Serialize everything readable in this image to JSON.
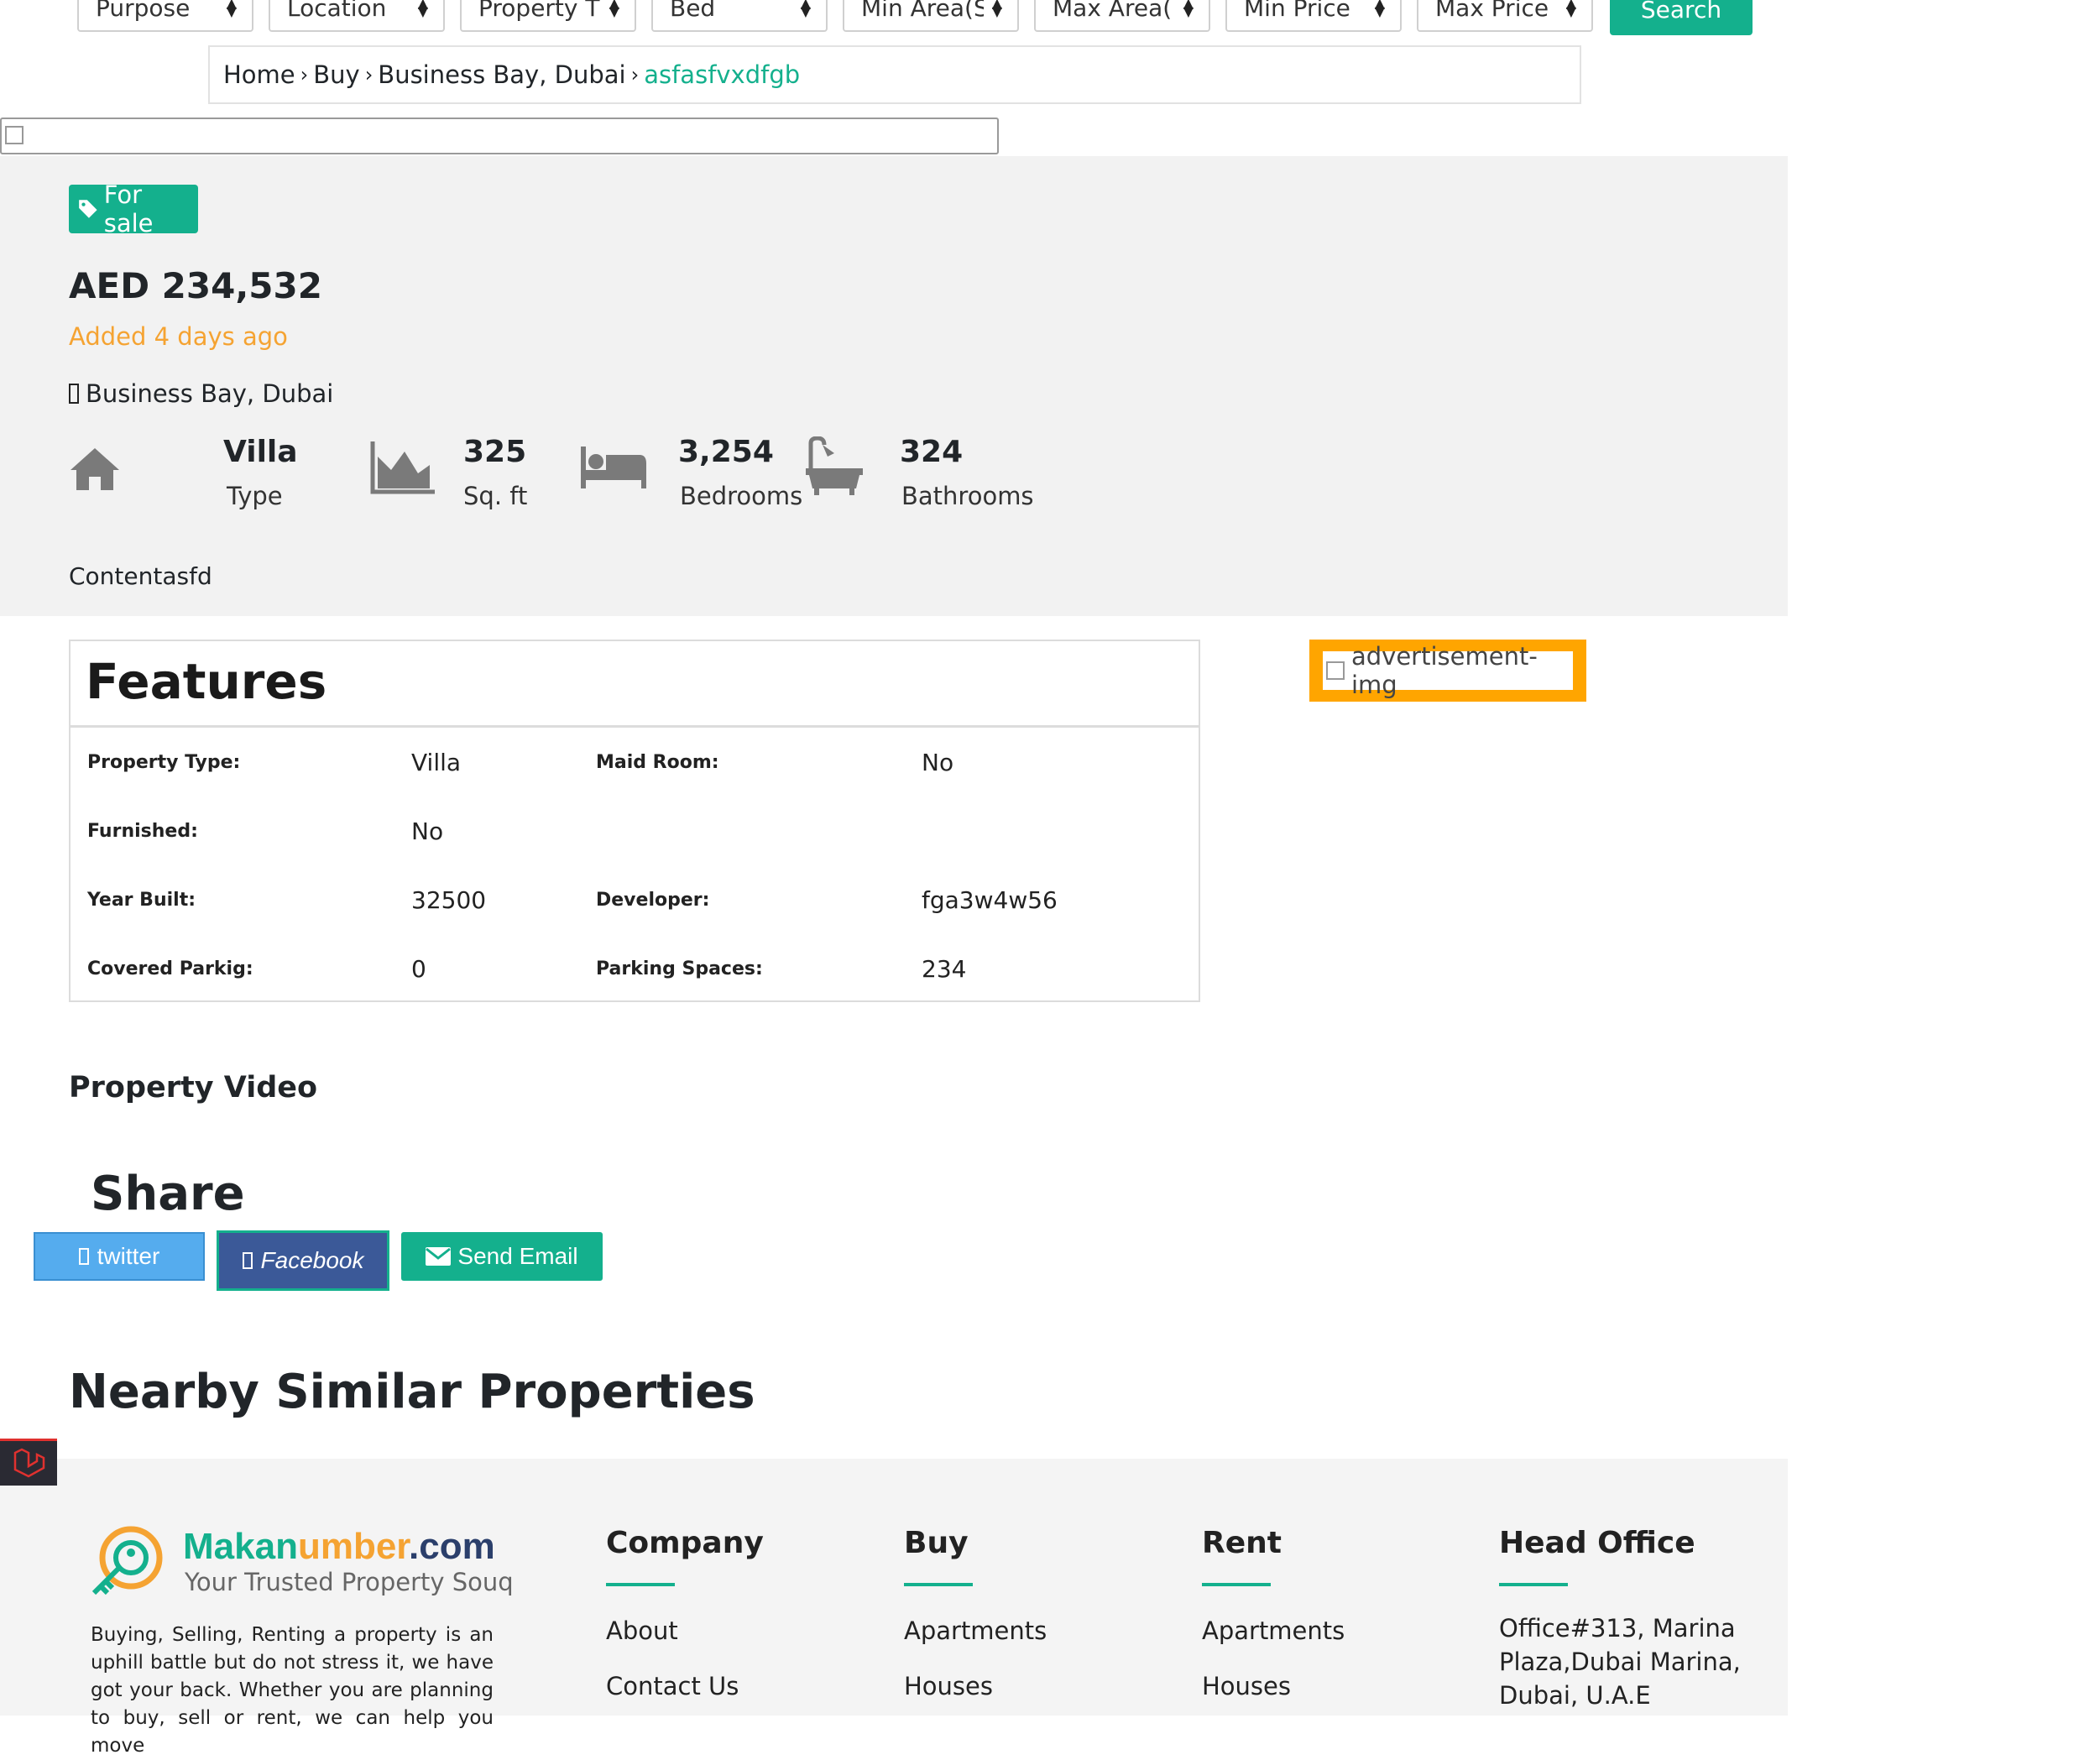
{
  "filters": [
    {
      "label": "Purpose"
    },
    {
      "label": "Location"
    },
    {
      "label": "Property T"
    },
    {
      "label": "Bed"
    },
    {
      "label": "Min Area(S"
    },
    {
      "label": "Max Area("
    },
    {
      "label": "Min Price"
    },
    {
      "label": "Max Price"
    }
  ],
  "search_label": "Search",
  "breadcrumb": {
    "home": "Home",
    "buy": "Buy",
    "location": "Business Bay, Dubai",
    "current": "asfasfvxdfgb"
  },
  "listing": {
    "badge": "For sale",
    "price": "AED 234,532",
    "added": "Added 4 days ago",
    "location": "Business Bay, Dubai",
    "content": "Contentasfd",
    "stats": {
      "type_value": "Villa",
      "type_label": "Type",
      "area_value": "325",
      "area_label": "Sq. ft",
      "bed_value": "3,254",
      "bed_label": "Bedrooms",
      "bath_value": "324",
      "bath_label": "Bathrooms"
    }
  },
  "features": {
    "title": "Features",
    "rows": [
      {
        "k1": "Property Type:",
        "v1": "Villa",
        "k2": "Maid Room:",
        "v2": "No"
      },
      {
        "k1": "Furnished:",
        "v1": "No",
        "k2": "",
        "v2": ""
      },
      {
        "k1": "Year Built:",
        "v1": "32500",
        "k2": "Developer:",
        "v2": "fga3w4w56"
      },
      {
        "k1": "Covered Parkig:",
        "v1": "0",
        "k2": "Parking Spaces:",
        "v2": "234"
      }
    ]
  },
  "advertisement_alt": "advertisement-img",
  "video_heading": "Property Video",
  "share": {
    "heading": "Share",
    "twitter": "twitter",
    "facebook": "Facebook",
    "email": "Send Email"
  },
  "nearby_heading": "Nearby Similar Properties",
  "footer": {
    "brand_part1": "Makan",
    "brand_part2": "umber",
    "brand_part3": ".com",
    "tagline": "Your Trusted Property Souq",
    "about_text": "Buying, Selling, Renting a property is an uphill battle but do not stress it, we have got your back. Whether you are planning to buy, sell or rent, we can help you move",
    "company": {
      "heading": "Company",
      "links": [
        "About",
        "Contact Us"
      ]
    },
    "buy": {
      "heading": "Buy",
      "links": [
        "Apartments",
        "Houses"
      ]
    },
    "rent": {
      "heading": "Rent",
      "links": [
        "Apartments",
        "Houses"
      ]
    },
    "office": {
      "heading": "Head Office",
      "address": "Office#313, Marina Plaza,Dubai Marina, Dubai, U.A.E"
    }
  },
  "colors": {
    "accent": "#14b08d",
    "orange": "#f5a332",
    "twitter": "#55acee",
    "facebook": "#3b5998"
  }
}
